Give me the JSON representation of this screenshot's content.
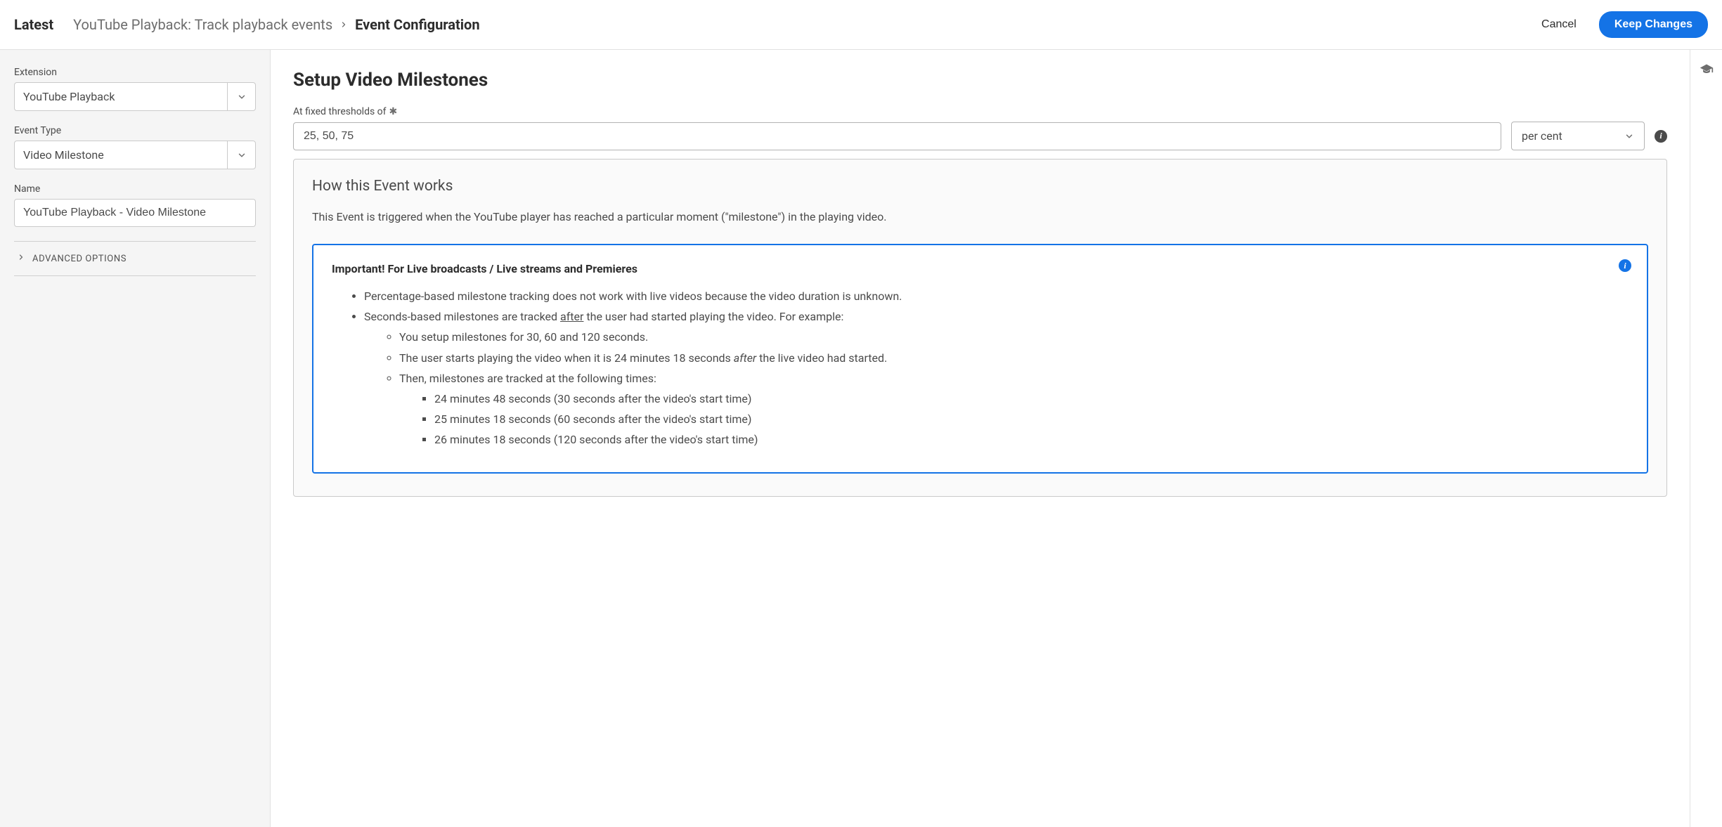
{
  "header": {
    "title": "Latest",
    "breadcrumb": {
      "parent": "YouTube Playback: Track playback events",
      "current": "Event Configuration"
    },
    "cancel_label": "Cancel",
    "save_label": "Keep Changes"
  },
  "sidebar": {
    "extension_label": "Extension",
    "extension_value": "YouTube Playback",
    "event_type_label": "Event Type",
    "event_type_value": "Video Milestone",
    "name_label": "Name",
    "name_value": "YouTube Playback - Video Milestone",
    "advanced_label": "ADVANCED OPTIONS"
  },
  "main": {
    "heading": "Setup Video Milestones",
    "threshold_label": "At fixed thresholds of",
    "threshold_value": "25, 50, 75",
    "unit_value": "per cent",
    "how": {
      "heading": "How this Event works",
      "desc": "This Event is triggered when the YouTube player has reached a particular moment (\"milestone\") in the playing video.",
      "callout_title": "Important! For Live broadcasts / Live streams and Premieres",
      "bullet1": "Percentage-based milestone tracking does not work with live videos because the video duration is unknown.",
      "bullet2_pre": "Seconds-based milestones are tracked ",
      "bullet2_underline": "after",
      "bullet2_post": " the user had started playing the video. For example:",
      "sub1": "You setup milestones for 30, 60 and 120 seconds.",
      "sub2_pre": "The user starts playing the video when it is 24 minutes 18 seconds ",
      "sub2_italic": "after",
      "sub2_post": " the live video had started.",
      "sub3": "Then, milestones are tracked at the following times:",
      "subsub1": "24 minutes 48 seconds (30 seconds after the video's start time)",
      "subsub2": "25 minutes 18 seconds (60 seconds after the video's start time)",
      "subsub3": "26 minutes 18 seconds (120 seconds after the video's start time)"
    }
  }
}
